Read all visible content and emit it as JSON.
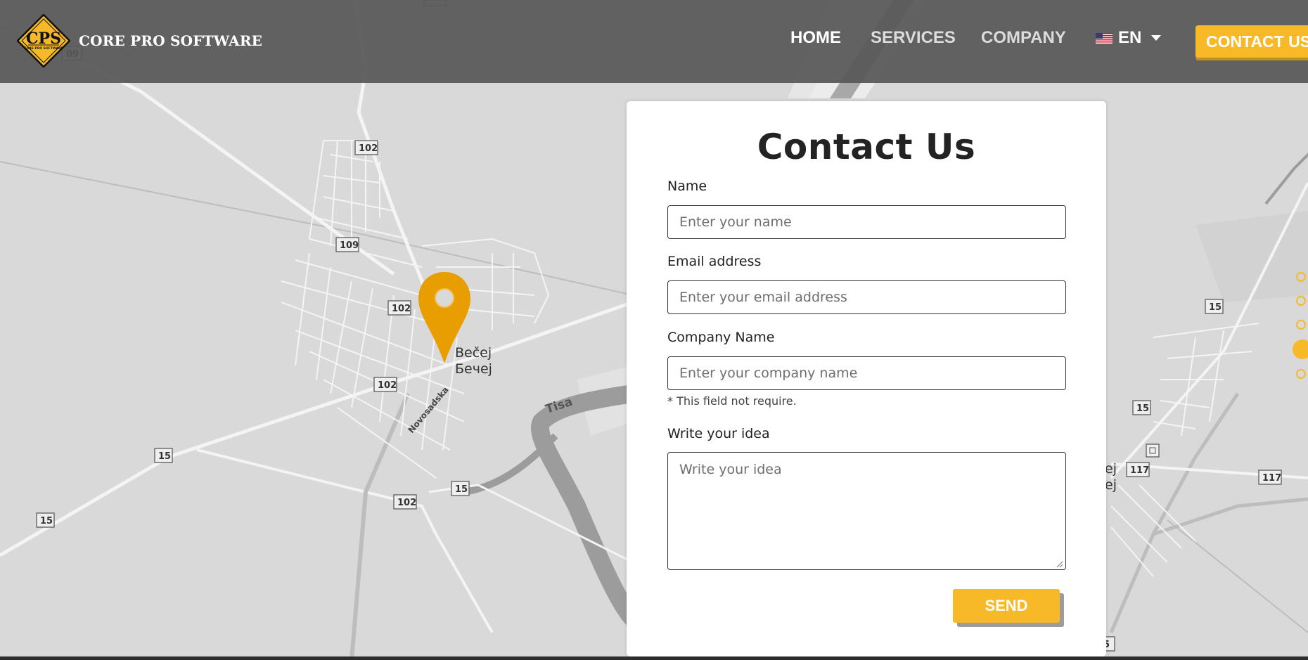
{
  "header": {
    "brand": "CORE PRO SOFTWARE",
    "logo_text": "CPS",
    "logo_subtext": "CORE PRO SOFTWARE",
    "nav": [
      {
        "label": "HOME"
      },
      {
        "label": "SERVICES"
      },
      {
        "label": "COMPANY"
      }
    ],
    "language": "EN",
    "contact_button": "CONTACT US"
  },
  "map": {
    "place_label_latin": "Bečej",
    "place_label_cyrillic": "Бечеј",
    "partial_label_1": "ej",
    "partial_label_2": "еј",
    "street_label": "Novosadska",
    "river_label": "Tisa",
    "road_shields": [
      "102",
      "102",
      "109",
      "102",
      "102",
      "15",
      "15",
      "15",
      "102",
      "15",
      "15",
      "117",
      "117",
      "09",
      "5"
    ],
    "pin_color": "#e89e00"
  },
  "form": {
    "title": "Contact Us",
    "name_label": "Name",
    "name_placeholder": "Enter your name",
    "email_label": "Email address",
    "email_placeholder": "Enter your email address",
    "company_label": "Company Name",
    "company_placeholder": "Enter your company name",
    "company_note": "* This field not require.",
    "idea_label": "Write your idea",
    "idea_placeholder": "Write your idea",
    "send_button": "SEND"
  },
  "pager": {
    "total": 5,
    "active": 4
  },
  "colors": {
    "accent": "#f7b928",
    "header_bg": "#575757",
    "map_bg": "#d9d9d9"
  }
}
